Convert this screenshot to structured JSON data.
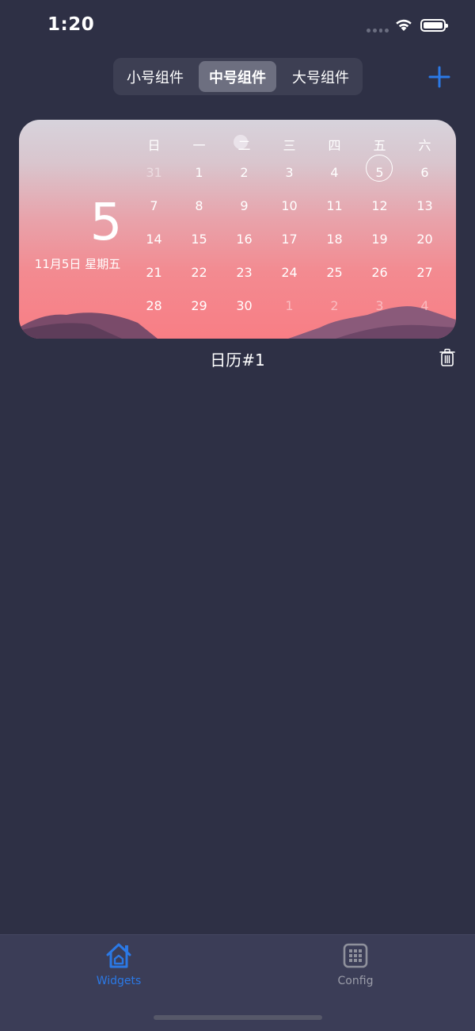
{
  "status": {
    "time": "1:20"
  },
  "segments": [
    "小号组件",
    "中号组件",
    "大号组件"
  ],
  "selected_segment": "中号组件",
  "widget": {
    "big_day": "5",
    "date_text": "11月5日 星期五",
    "weekdays": [
      "日",
      "一",
      "二",
      "三",
      "四",
      "五",
      "六"
    ],
    "weeks": [
      [
        "31",
        "1",
        "2",
        "3",
        "4",
        "5",
        "6"
      ],
      [
        "7",
        "8",
        "9",
        "10",
        "11",
        "12",
        "13"
      ],
      [
        "14",
        "15",
        "16",
        "17",
        "18",
        "19",
        "20"
      ],
      [
        "21",
        "22",
        "23",
        "24",
        "25",
        "26",
        "27"
      ],
      [
        "28",
        "29",
        "30",
        "1",
        "2",
        "3",
        "4"
      ]
    ],
    "today": "5",
    "name": "日历#1"
  },
  "tabs": {
    "widgets": "Widgets",
    "config": "Config"
  },
  "colors": {
    "accent": "#2b79e6",
    "background": "#2e3045",
    "tab_bar": "#3b3d57"
  },
  "icons": {
    "add": "plus-icon",
    "delete": "trash-icon",
    "widgets_tab": "house-icon",
    "config_tab": "grid-icon"
  }
}
